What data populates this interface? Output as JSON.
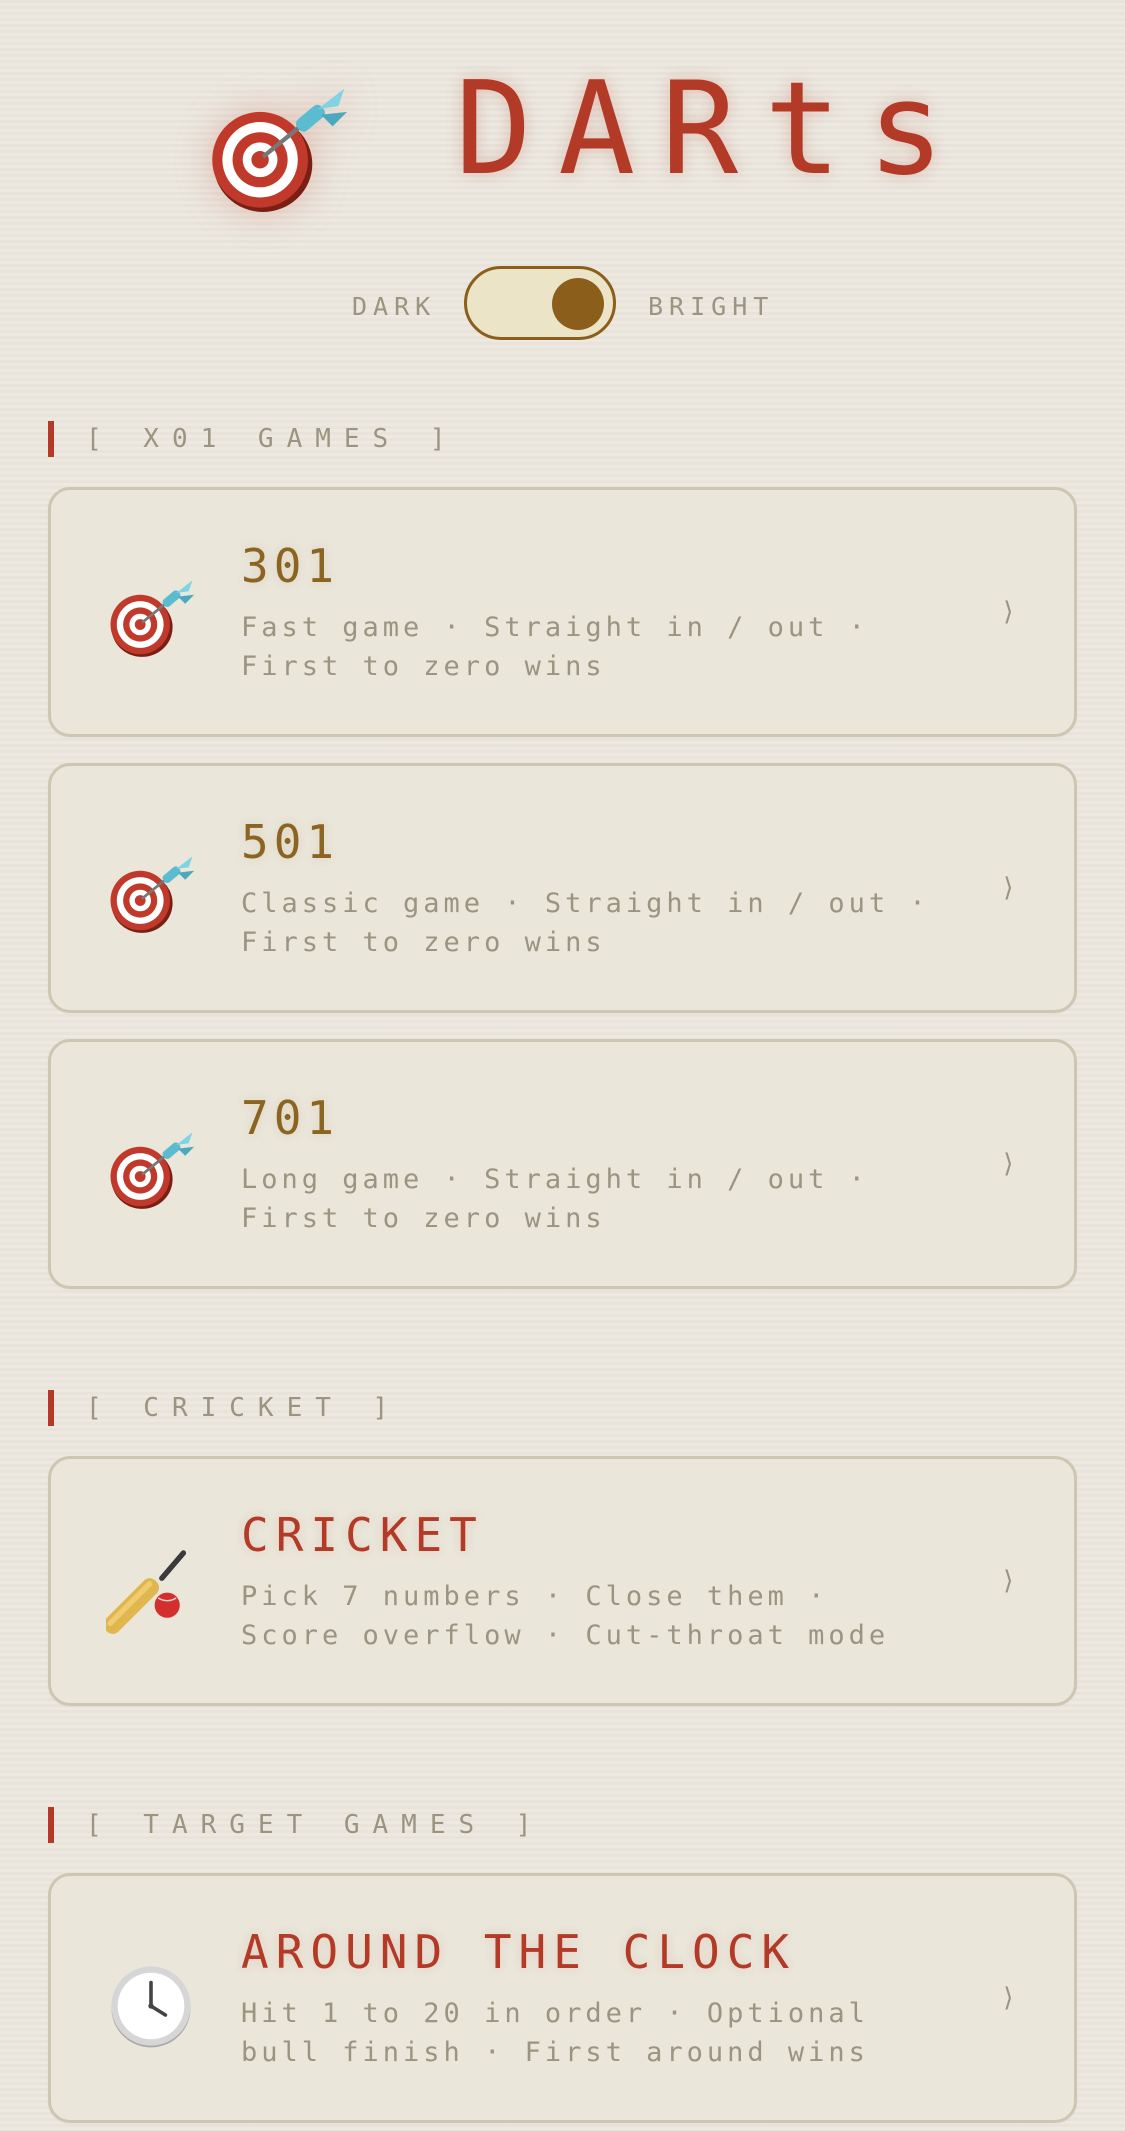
{
  "header": {
    "logo_icon": "dart-target-icon",
    "title": "DARts"
  },
  "theme": {
    "dark_label": "DARK",
    "bright_label": "BRIGHT",
    "selected": "BRIGHT"
  },
  "colors": {
    "accent_red": "#b23a26",
    "accent_gold": "#8b6422",
    "background": "#ece8df",
    "card": "#eae6da"
  },
  "sections": {
    "x01": {
      "title": "[ X01 GAMES ]",
      "games": [
        {
          "icon": "dart-target-icon",
          "title": "301",
          "desc": "Fast game · Straight in / out · First to zero wins",
          "chevron": "⟩"
        },
        {
          "icon": "dart-target-icon",
          "title": "501",
          "desc": "Classic game · Straight in / out · First to zero wins",
          "chevron": "⟩"
        },
        {
          "icon": "dart-target-icon",
          "title": "701",
          "desc": "Long game · Straight in / out · First to zero wins",
          "chevron": "⟩"
        }
      ]
    },
    "cricket": {
      "title": "[ CRICKET ]",
      "games": [
        {
          "icon": "cricket-bat-icon",
          "title": "CRICKET",
          "desc": "Pick 7 numbers · Close them · Score overflow · Cut-throat mode",
          "chevron": "⟩"
        }
      ]
    },
    "target": {
      "title": "[ TARGET GAMES ]",
      "games": [
        {
          "icon": "clock-icon",
          "title": "AROUND THE CLOCK",
          "desc": "Hit 1 to 20 in order · Optional bull finish · First around wins",
          "chevron": "⟩"
        }
      ]
    }
  }
}
